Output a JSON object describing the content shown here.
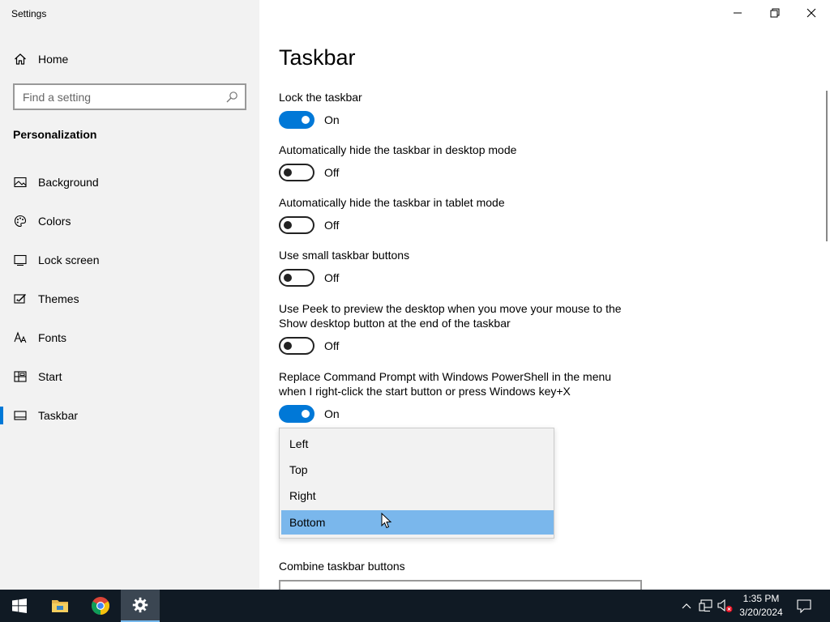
{
  "window": {
    "title": "Settings",
    "minimize_icon": "minimize-icon",
    "maximize_icon": "restore-icon",
    "close_icon": "close-icon"
  },
  "sidebar": {
    "home": {
      "label": "Home",
      "icon": "home-icon"
    },
    "search": {
      "placeholder": "Find a setting",
      "value": "",
      "icon": "search-icon"
    },
    "section": "Personalization",
    "items": [
      {
        "label": "Background",
        "icon": "picture-icon",
        "active": false
      },
      {
        "label": "Colors",
        "icon": "palette-icon",
        "active": false
      },
      {
        "label": "Lock screen",
        "icon": "lock-screen-icon",
        "active": false
      },
      {
        "label": "Themes",
        "icon": "themes-icon",
        "active": false
      },
      {
        "label": "Fonts",
        "icon": "font-icon",
        "active": false
      },
      {
        "label": "Start",
        "icon": "start-icon",
        "active": false
      },
      {
        "label": "Taskbar",
        "icon": "taskbar-icon",
        "active": true
      }
    ]
  },
  "main": {
    "title": "Taskbar",
    "settings": [
      {
        "label": "Lock the taskbar",
        "state": "On",
        "on": true
      },
      {
        "label": "Automatically hide the taskbar in desktop mode",
        "state": "Off",
        "on": false
      },
      {
        "label": "Automatically hide the taskbar in tablet mode",
        "state": "Off",
        "on": false
      },
      {
        "label": "Use small taskbar buttons",
        "state": "Off",
        "on": false
      },
      {
        "label": "Use Peek to preview the desktop when you move your mouse to the Show desktop button at the end of the taskbar",
        "state": "Off",
        "on": false
      },
      {
        "label": "Replace Command Prompt with Windows PowerShell in the menu when I right-click the start button or press Windows key+X",
        "state": "On",
        "on": true
      }
    ],
    "location_dropdown": {
      "options": [
        "Left",
        "Top",
        "Right",
        "Bottom"
      ],
      "selected": "Bottom"
    },
    "combine_label": "Combine taskbar buttons"
  },
  "colors": {
    "accent": "#0078d7",
    "sidebar_bg": "#f2f2f2",
    "selected_option": "#7ab7ec",
    "taskbar_bg": "#101a24"
  },
  "taskbar": {
    "apps": [
      {
        "name": "start-button",
        "icon": "windows-icon"
      },
      {
        "name": "file-explorer",
        "icon": "folder-icon"
      },
      {
        "name": "chrome",
        "icon": "chrome-icon"
      },
      {
        "name": "settings",
        "icon": "gear-icon",
        "active": true
      }
    ],
    "tray": [
      "chevron-up-icon",
      "network-icon",
      "volume-muted-icon",
      "notification-icon"
    ],
    "clock": {
      "time": "1:35 PM",
      "date": "3/20/2024"
    }
  }
}
